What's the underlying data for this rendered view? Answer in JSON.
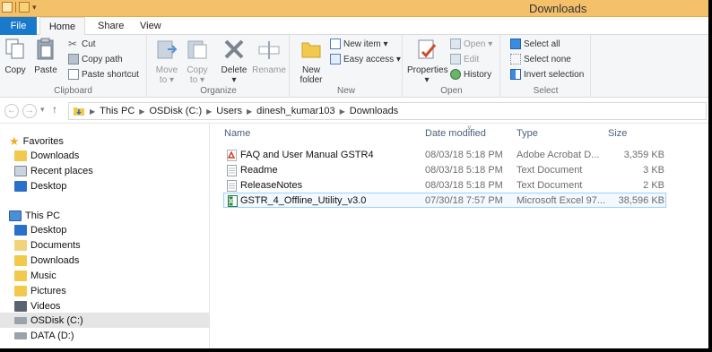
{
  "window": {
    "title": "Downloads"
  },
  "tabs": {
    "file": "File",
    "home": "Home",
    "share": "Share",
    "view": "View"
  },
  "ribbon": {
    "clipboard": {
      "label": "Clipboard",
      "copy": "Copy",
      "paste": "Paste",
      "cut": "Cut",
      "copy_path": "Copy path",
      "paste_shortcut": "Paste shortcut"
    },
    "organize": {
      "label": "Organize",
      "move_to": "Move",
      "move_to2": "to ▾",
      "copy_to": "Copy",
      "copy_to2": "to ▾",
      "delete": "Delete",
      "delete2": "▾",
      "rename": "Rename"
    },
    "new": {
      "label": "New",
      "new_folder": "New",
      "new_folder2": "folder",
      "new_item": "New item ▾",
      "easy_access": "Easy access ▾"
    },
    "open": {
      "label": "Open",
      "properties": "Properties",
      "properties2": "▾",
      "open": "Open ▾",
      "edit": "Edit",
      "history": "History"
    },
    "select": {
      "label": "Select",
      "select_all": "Select all",
      "select_none": "Select none",
      "invert_selection": "Invert selection"
    }
  },
  "address": {
    "crumbs": [
      "This PC",
      "OSDisk (C:)",
      "Users",
      "dinesh_kumar103",
      "Downloads"
    ]
  },
  "nav": {
    "favorites": {
      "label": "Favorites",
      "items": [
        "Downloads",
        "Recent places",
        "Desktop"
      ]
    },
    "this_pc": {
      "label": "This PC",
      "items": [
        "Desktop",
        "Documents",
        "Downloads",
        "Music",
        "Pictures",
        "Videos",
        "OSDisk (C:)",
        "DATA (D:)"
      ]
    }
  },
  "files": {
    "columns": {
      "name": "Name",
      "date": "Date modified",
      "type": "Type",
      "size": "Size"
    },
    "rows": [
      {
        "name": "FAQ and User Manual GSTR4",
        "date": "08/03/18 5:18 PM",
        "type": "Adobe Acrobat D...",
        "size": "3,359 KB",
        "icon": "pdf-icon"
      },
      {
        "name": "Readme",
        "date": "08/03/18 5:18 PM",
        "type": "Text Document",
        "size": "3 KB",
        "icon": "text-file-icon"
      },
      {
        "name": "ReleaseNotes",
        "date": "08/03/18 5:18 PM",
        "type": "Text Document",
        "size": "2 KB",
        "icon": "text-file-icon"
      },
      {
        "name": "GSTR_4_Offline_Utility_v3.0",
        "date": "07/30/18 7:57 PM",
        "type": "Microsoft Excel 97...",
        "size": "38,596 KB",
        "icon": "excel-icon"
      }
    ]
  },
  "colors": {
    "accent": "#1979ca",
    "title_bar": "#f4c06a",
    "selection_border": "#99d1ff"
  }
}
